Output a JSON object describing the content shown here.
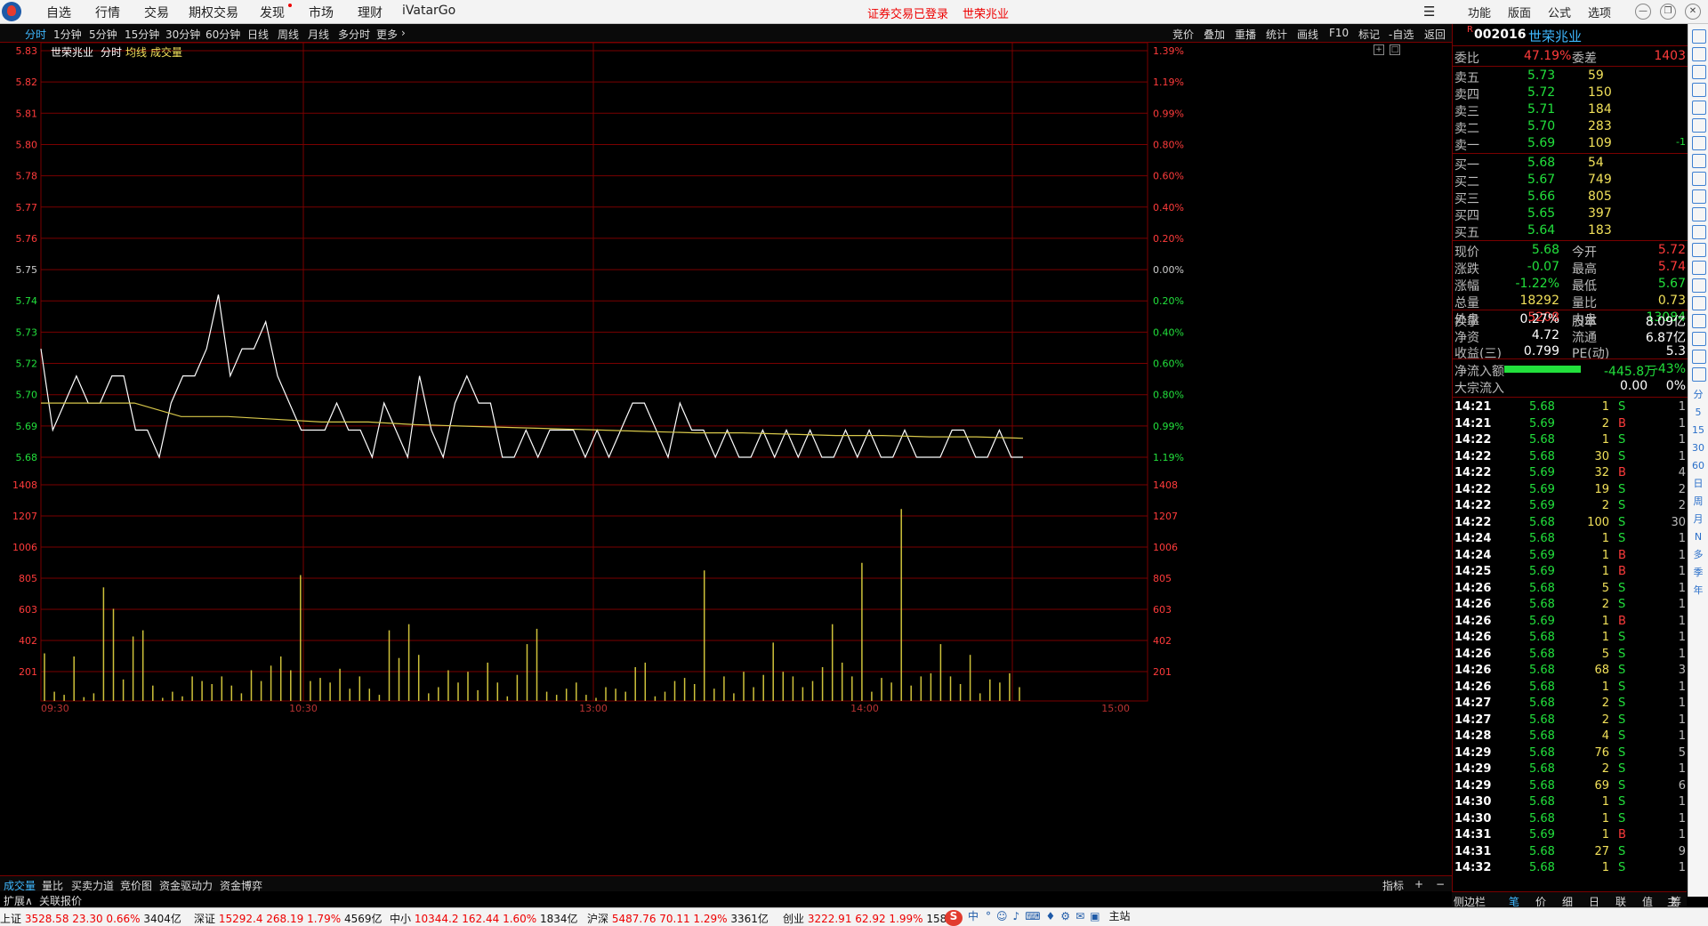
{
  "menubar": {
    "items": [
      "自选",
      "行情",
      "交易",
      "期权交易",
      "发现",
      "市场",
      "理财",
      "iVatarGo"
    ],
    "status": "证券交易已登录",
    "stock_name": "世荣兆业",
    "right_items": [
      "功能",
      "版面",
      "公式",
      "选项"
    ]
  },
  "toolbar": {
    "periods": [
      "分时",
      "1分钟",
      "5分钟",
      "15分钟",
      "30分钟",
      "60分钟",
      "日线",
      "周线",
      "月线",
      "多分时",
      "更多"
    ],
    "right": [
      "竞价",
      "叠加",
      "重播",
      "统计",
      "画线",
      "F10",
      "标记",
      "-自选",
      "返回"
    ]
  },
  "chart_header": {
    "name": "世荣兆业",
    "view": "分时",
    "avg_label": "均线",
    "vol_label": "成交量"
  },
  "price_axis": {
    "left_labels": [
      "5.83",
      "5.82",
      "5.81",
      "5.80",
      "5.78",
      "5.77",
      "5.76",
      "5.75",
      "5.74",
      "5.73",
      "5.72",
      "5.70",
      "5.69",
      "5.68"
    ],
    "right_labels": [
      "1.39%",
      "1.19%",
      "0.99%",
      "0.80%",
      "0.60%",
      "0.40%",
      "0.20%",
      "0.00%",
      "0.20%",
      "0.40%",
      "0.60%",
      "0.80%",
      "0.99%",
      "1.19%"
    ]
  },
  "volume_axis": {
    "labels": [
      "1408",
      "1207",
      "1006",
      "805",
      "603",
      "402",
      "201"
    ]
  },
  "time_axis": [
    "09:30",
    "10:30",
    "13:00",
    "14:00",
    "15:00"
  ],
  "chart_data": {
    "type": "line",
    "x_range": [
      "09:30",
      "15:00"
    ],
    "ylim": [
      5.68,
      5.83
    ],
    "price_series_name": "分时",
    "avg_series_name": "均线",
    "price_points": [
      5.72,
      5.69,
      5.7,
      5.71,
      5.7,
      5.7,
      5.71,
      5.71,
      5.69,
      5.69,
      5.68,
      5.7,
      5.71,
      5.71,
      5.72,
      5.74,
      5.71,
      5.72,
      5.72,
      5.73,
      5.71,
      5.7,
      5.69,
      5.69,
      5.69,
      5.7,
      5.69,
      5.69,
      5.68,
      5.7,
      5.69,
      5.68,
      5.71,
      5.69,
      5.68,
      5.7,
      5.71,
      5.7,
      5.7,
      5.68,
      5.68,
      5.69,
      5.68,
      5.69,
      5.69,
      5.69,
      5.68,
      5.69,
      5.68,
      5.69,
      5.7,
      5.7,
      5.69,
      5.68,
      5.7,
      5.69,
      5.69,
      5.68,
      5.69,
      5.68,
      5.68,
      5.69,
      5.68,
      5.69,
      5.68,
      5.69,
      5.68,
      5.68,
      5.69,
      5.68,
      5.69,
      5.68,
      5.68,
      5.69,
      5.68,
      5.68,
      5.68,
      5.69,
      5.69,
      5.68,
      5.68,
      5.69,
      5.68,
      5.68
    ],
    "avg_points": [
      5.7,
      5.7,
      5.7,
      5.695,
      5.695,
      5.694,
      5.693,
      5.693,
      5.692,
      5.6915,
      5.691,
      5.6905,
      5.69,
      5.6895,
      5.689,
      5.689,
      5.6885,
      5.688,
      5.688,
      5.6875,
      5.6875,
      5.687
    ],
    "volume_ylim": [
      0,
      1408
    ],
    "volume_bars": [
      310,
      60,
      40,
      290,
      25,
      50,
      740,
      600,
      140,
      420,
      460,
      100,
      20,
      60,
      30,
      160,
      130,
      110,
      160,
      100,
      50,
      200,
      130,
      230,
      290,
      200,
      820,
      130,
      150,
      120,
      210,
      80,
      160,
      80,
      40,
      460,
      280,
      500,
      300,
      50,
      90,
      200,
      120,
      190,
      70,
      250,
      120,
      30,
      170,
      370,
      470,
      60,
      40,
      80,
      120,
      40,
      20,
      90,
      80,
      60,
      220,
      250,
      30,
      60,
      130,
      150,
      110,
      850,
      80,
      160,
      50,
      190,
      90,
      170,
      380,
      190,
      160,
      90,
      130,
      220,
      500,
      250,
      160,
      900,
      60,
      150,
      120,
      1250,
      100,
      160,
      180,
      370,
      160,
      110,
      300,
      50,
      140,
      120,
      180,
      90
    ],
    "vol_note": ""
  },
  "quote": {
    "code": "002016",
    "name": "世荣兆业",
    "wb_label": "委比",
    "wb": "47.19%",
    "wc_label": "委差",
    "wc": "1403",
    "asks": [
      {
        "label": "卖五",
        "price": "5.73",
        "vol": "59"
      },
      {
        "label": "卖四",
        "price": "5.72",
        "vol": "150"
      },
      {
        "label": "卖三",
        "price": "5.71",
        "vol": "184"
      },
      {
        "label": "卖二",
        "price": "5.70",
        "vol": "283"
      },
      {
        "label": "卖一",
        "price": "5.69",
        "vol": "109",
        "chg": "-1"
      }
    ],
    "bids": [
      {
        "label": "买一",
        "price": "5.68",
        "vol": "54"
      },
      {
        "label": "买二",
        "price": "5.67",
        "vol": "749"
      },
      {
        "label": "买三",
        "price": "5.66",
        "vol": "805"
      },
      {
        "label": "买四",
        "price": "5.65",
        "vol": "397"
      },
      {
        "label": "买五",
        "price": "5.64",
        "vol": "183"
      }
    ],
    "stats1": [
      {
        "l1": "现价",
        "v1": "5.68",
        "c1": "green",
        "l2": "今开",
        "v2": "5.72",
        "c2": "red"
      },
      {
        "l1": "涨跌",
        "v1": "-0.07",
        "c1": "green",
        "l2": "最高",
        "v2": "5.74",
        "c2": "red"
      },
      {
        "l1": "涨幅",
        "v1": "-1.22%",
        "c1": "green",
        "l2": "最低",
        "v2": "5.67",
        "c2": "green"
      },
      {
        "l1": "总量",
        "v1": "18292",
        "c1": "yellow",
        "l2": "量比",
        "v2": "0.73",
        "c2": "yellow"
      },
      {
        "l1": "外盘",
        "v1": "5208",
        "c1": "red",
        "l2": "内盘",
        "v2": "13084",
        "c2": "green"
      }
    ],
    "stats2": [
      {
        "l1": "换手",
        "v1": "0.27%",
        "l2": "股本",
        "v2": "8.09亿"
      },
      {
        "l1": "净资",
        "v1": "4.72",
        "l2": "流通",
        "v2": "6.87亿"
      },
      {
        "l1": "收益(三)",
        "v1": "0.799",
        "l2": "PE(动)",
        "v2": "5.3"
      }
    ],
    "flow": {
      "label": "净流入额",
      "value": "-445.8万",
      "pct": "-43%",
      "fill": 0.43
    },
    "block": {
      "label": "大宗流入",
      "value": "0.00",
      "pct": "0%"
    }
  },
  "ticks": [
    {
      "t": "14:21",
      "p": "5.68",
      "v": "1",
      "d": "S",
      "n": "1"
    },
    {
      "t": "14:21",
      "p": "5.69",
      "v": "2",
      "d": "B",
      "n": "1"
    },
    {
      "t": "14:22",
      "p": "5.68",
      "v": "1",
      "d": "S",
      "n": "1"
    },
    {
      "t": "14:22",
      "p": "5.68",
      "v": "30",
      "d": "S",
      "n": "1"
    },
    {
      "t": "14:22",
      "p": "5.69",
      "v": "32",
      "d": "B",
      "n": "4"
    },
    {
      "t": "14:22",
      "p": "5.69",
      "v": "19",
      "d": "S",
      "n": "2"
    },
    {
      "t": "14:22",
      "p": "5.69",
      "v": "2",
      "d": "S",
      "n": "2"
    },
    {
      "t": "14:22",
      "p": "5.68",
      "v": "100",
      "d": "S",
      "n": "30"
    },
    {
      "t": "14:24",
      "p": "5.68",
      "v": "1",
      "d": "S",
      "n": "1"
    },
    {
      "t": "14:24",
      "p": "5.69",
      "v": "1",
      "d": "B",
      "n": "1"
    },
    {
      "t": "14:25",
      "p": "5.69",
      "v": "1",
      "d": "B",
      "n": "1"
    },
    {
      "t": "14:26",
      "p": "5.68",
      "v": "5",
      "d": "S",
      "n": "1"
    },
    {
      "t": "14:26",
      "p": "5.68",
      "v": "2",
      "d": "S",
      "n": "1"
    },
    {
      "t": "14:26",
      "p": "5.69",
      "v": "1",
      "d": "B",
      "n": "1"
    },
    {
      "t": "14:26",
      "p": "5.68",
      "v": "1",
      "d": "S",
      "n": "1"
    },
    {
      "t": "14:26",
      "p": "5.68",
      "v": "5",
      "d": "S",
      "n": "1"
    },
    {
      "t": "14:26",
      "p": "5.68",
      "v": "68",
      "d": "S",
      "n": "3"
    },
    {
      "t": "14:26",
      "p": "5.68",
      "v": "1",
      "d": "S",
      "n": "1"
    },
    {
      "t": "14:27",
      "p": "5.68",
      "v": "2",
      "d": "S",
      "n": "1"
    },
    {
      "t": "14:27",
      "p": "5.68",
      "v": "2",
      "d": "S",
      "n": "1"
    },
    {
      "t": "14:28",
      "p": "5.68",
      "v": "4",
      "d": "S",
      "n": "1"
    },
    {
      "t": "14:29",
      "p": "5.68",
      "v": "76",
      "d": "S",
      "n": "5"
    },
    {
      "t": "14:29",
      "p": "5.68",
      "v": "2",
      "d": "S",
      "n": "1"
    },
    {
      "t": "14:29",
      "p": "5.68",
      "v": "69",
      "d": "S",
      "n": "6"
    },
    {
      "t": "14:30",
      "p": "5.68",
      "v": "1",
      "d": "S",
      "n": "1"
    },
    {
      "t": "14:30",
      "p": "5.68",
      "v": "1",
      "d": "S",
      "n": "1"
    },
    {
      "t": "14:31",
      "p": "5.69",
      "v": "1",
      "d": "B",
      "n": "1"
    },
    {
      "t": "14:31",
      "p": "5.68",
      "v": "27",
      "d": "S",
      "n": "9"
    },
    {
      "t": "14:32",
      "p": "5.68",
      "v": "1",
      "d": "S",
      "n": "1"
    }
  ],
  "bottom_tabs": [
    "成交量",
    "量比",
    "买卖力道",
    "竞价图",
    "资金驱动力",
    "资金博弈"
  ],
  "bottom_right": [
    "指标",
    "+",
    "−"
  ],
  "expand": {
    "a": "扩展∧",
    "b": "关联报价"
  },
  "right_tabs": [
    "侧边栏",
    "笔",
    "价",
    "细",
    "日",
    "联",
    "值",
    "主",
    "筹"
  ],
  "strip_icons": [
    "分",
    "5",
    "15",
    "30",
    "60",
    "日",
    "周",
    "月",
    "N",
    "多",
    "季",
    "年"
  ],
  "ticker": [
    {
      "lbl": "上证",
      "v": "3528.58",
      "c": "23.30",
      "p": "0.66%",
      "a": "3404亿"
    },
    {
      "lbl": "深证",
      "v": "15292.4",
      "c": "268.19",
      "p": "1.79%",
      "a": "4569亿"
    },
    {
      "lbl": "中小",
      "v": "10344.2",
      "c": "162.44",
      "p": "1.60%",
      "a": "1834亿"
    },
    {
      "lbl": "沪深",
      "v": "5487.76",
      "c": "70.11",
      "p": "1.29%",
      "a": "3361亿"
    },
    {
      "lbl": "创业",
      "v": "3222.91",
      "c": "62.92",
      "p": "1.99%",
      "a": "158"
    }
  ],
  "tray": [
    "中",
    "主站"
  ],
  "colors": {
    "up": "#ff3b3b",
    "down": "#22e03c",
    "avg": "#d8c84a",
    "vol": "#cfc23a",
    "grid": "#7a0000"
  }
}
